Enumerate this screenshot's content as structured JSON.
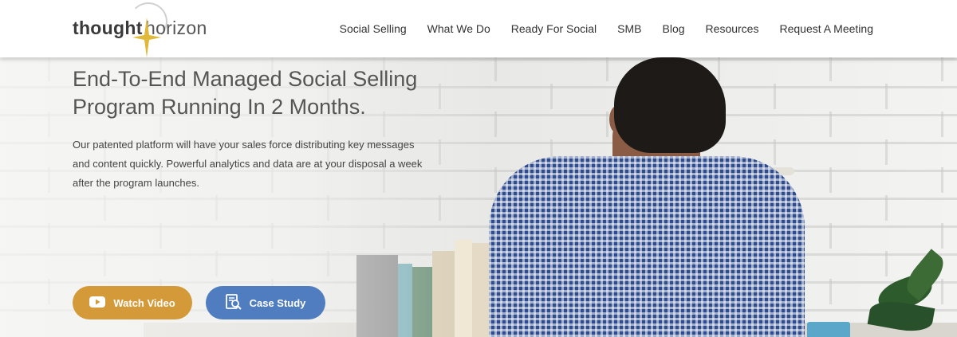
{
  "brand": {
    "logo_part_1": "thought",
    "logo_part_2": "horizon",
    "star_color": "#e0b83a"
  },
  "nav": {
    "items": [
      {
        "label": "Social Selling"
      },
      {
        "label": "What We Do"
      },
      {
        "label": "Ready For Social"
      },
      {
        "label": "SMB"
      },
      {
        "label": "Blog"
      },
      {
        "label": "Resources"
      },
      {
        "label": "Request A Meeting"
      }
    ]
  },
  "hero": {
    "headline_line_1": "End-To-End Managed Social Selling",
    "headline_line_2": "Program Running In 2 Months.",
    "subtext_line_1": "Our patented platform will have your sales force distributing key messages",
    "subtext_line_2": "and content quickly. Powerful analytics and data are at your disposal a week",
    "subtext_line_3": "after the program launches."
  },
  "buttons": {
    "watch_video": {
      "label": "Watch Video",
      "icon": "youtube-play-icon",
      "color": "#d49a3a"
    },
    "case_study": {
      "label": "Case Study",
      "icon": "document-search-icon",
      "color": "#4f7dc0"
    }
  }
}
